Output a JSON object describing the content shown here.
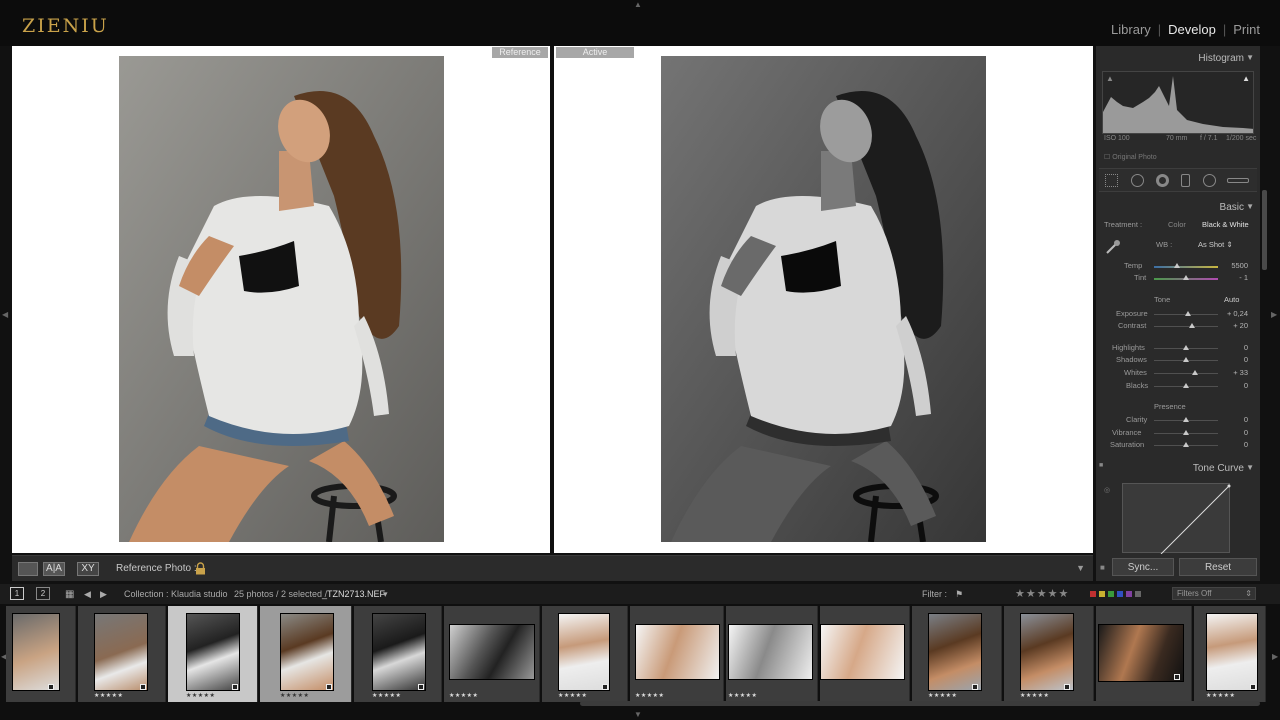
{
  "app": {
    "logo": "ZIENIU"
  },
  "modules": [
    {
      "label": "Library",
      "active": false
    },
    {
      "label": "Develop",
      "active": true
    },
    {
      "label": "Print",
      "active": false
    }
  ],
  "compare": {
    "reference_tag": "Reference",
    "active_tag": "Active"
  },
  "viewer_toolbar": {
    "ab_label": "A|A",
    "xy_label": "XY",
    "reference_photo_label": "Reference Photo :"
  },
  "right_panel": {
    "histogram": {
      "title": "Histogram",
      "iso": "ISO 100",
      "focal": "70 mm",
      "aperture": "f / 7.1",
      "shutter": "1/200 sec",
      "original_photo": "Original Photo"
    },
    "basic": {
      "title": "Basic",
      "treatment_label": "Treatment :",
      "treatment_color": "Color",
      "treatment_bw": "Black & White",
      "wb_label": "WB :",
      "wb_value": "As Shot",
      "temp_label": "Temp",
      "temp_value": "5500",
      "tint_label": "Tint",
      "tint_value": "- 1",
      "tone_label": "Tone",
      "auto_label": "Auto",
      "sliders": [
        {
          "label": "Exposure",
          "value": "+ 0,24"
        },
        {
          "label": "Contrast",
          "value": "+ 20"
        },
        {
          "label": "Highlights",
          "value": "0"
        },
        {
          "label": "Shadows",
          "value": "0"
        },
        {
          "label": "Whites",
          "value": "+ 33"
        },
        {
          "label": "Blacks",
          "value": "0"
        }
      ],
      "presence_label": "Presence",
      "presence_sliders": [
        {
          "label": "Clarity",
          "value": "0"
        },
        {
          "label": "Vibrance",
          "value": "0"
        },
        {
          "label": "Saturation",
          "value": "0"
        }
      ]
    },
    "tone_curve": {
      "title": "Tone Curve"
    },
    "sync_label": "Sync...",
    "reset_label": "Reset"
  },
  "filmstrip_bar": {
    "page1": "1",
    "page2": "2",
    "collection": "Collection : Klaudia studio",
    "count": "25 photos / 2 selected /",
    "filename": "_TZN2713.NEF",
    "filter_label": "Filter :",
    "stars": "★★★★★",
    "filters_off": "Filters Off",
    "label_colors": [
      "#c03030",
      "#c8b030",
      "#3a9a3a",
      "#3050c0",
      "#8040a0",
      "#666666"
    ]
  },
  "filmstrip": {
    "stars": "★★★★★"
  }
}
